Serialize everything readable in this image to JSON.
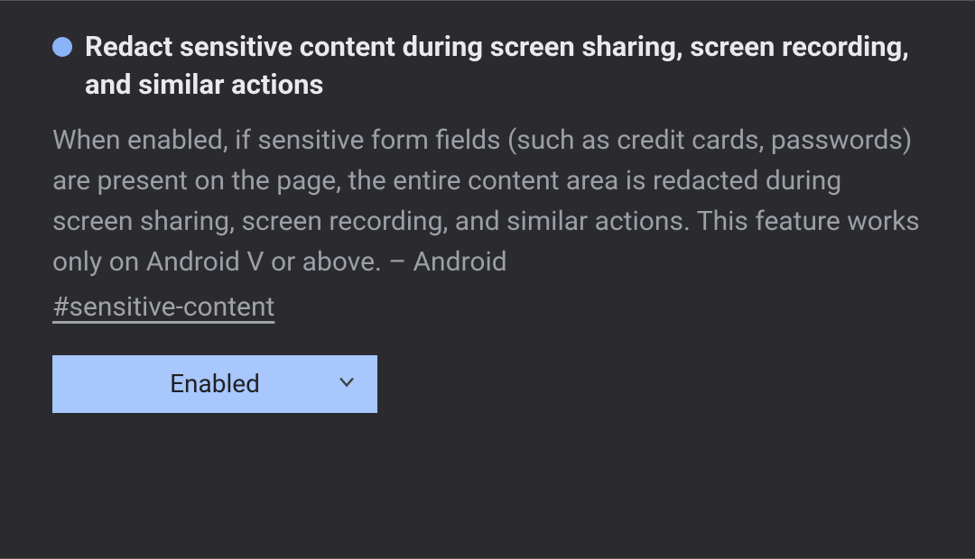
{
  "flag": {
    "title": "Redact sensitive content during screen sharing, screen recording, and similar actions",
    "description": "When enabled, if sensitive form fields (such as credit cards, passwords) are present on the page, the entire content area is redacted during screen sharing, screen recording, and similar actions. This feature works only on Android V or above. – Android",
    "anchor": "#sensitive-content",
    "selected_option": "Enabled",
    "modified": true,
    "modified_color": "#8ab4f8",
    "select_bg": "#a8c7fc"
  }
}
